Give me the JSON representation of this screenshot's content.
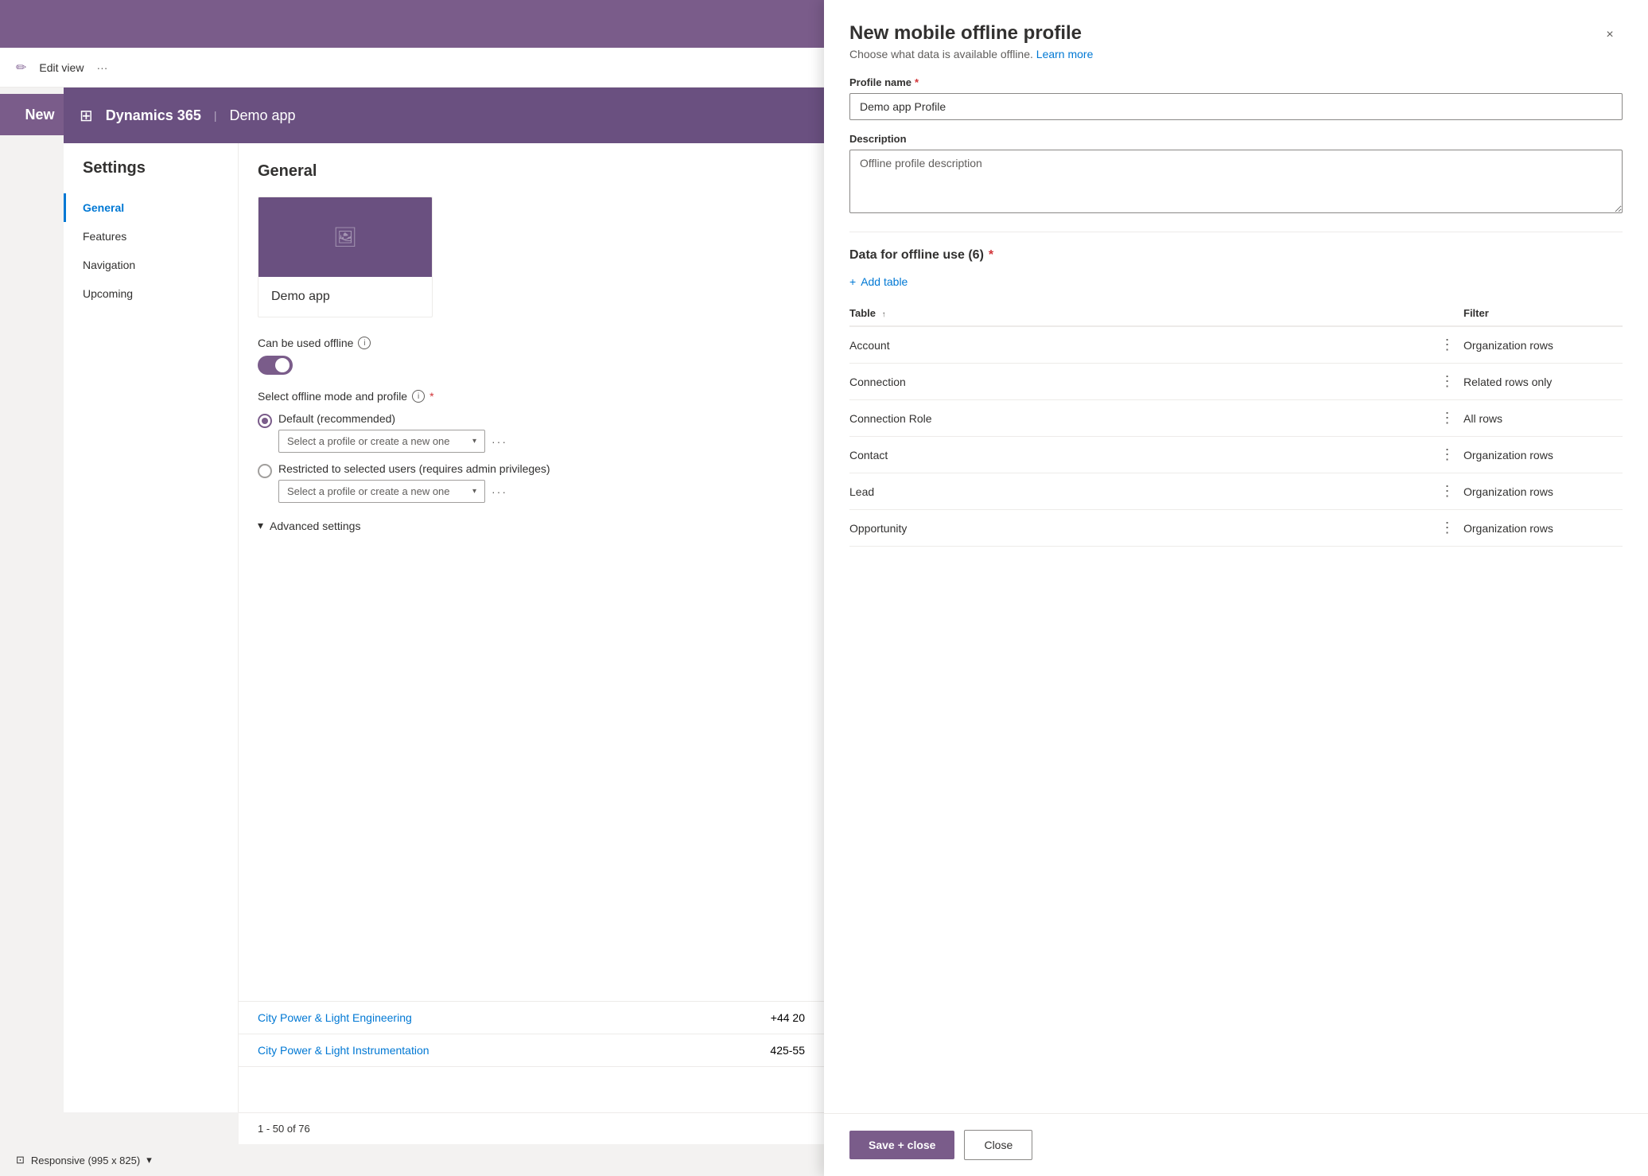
{
  "app": {
    "top_bar_color": "#7a5c8a",
    "dynamics_title": "Dynamics 365",
    "app_name": "Demo app"
  },
  "toolbar": {
    "edit_view": "Edit view",
    "new_btn": "New"
  },
  "settings": {
    "title": "Settings",
    "nav_items": [
      {
        "label": "General",
        "active": true
      },
      {
        "label": "Features",
        "active": false
      },
      {
        "label": "Navigation",
        "active": false
      },
      {
        "label": "Upcoming",
        "active": false
      }
    ]
  },
  "general": {
    "title": "General",
    "app_card_name": "Demo app",
    "offline_label": "Can be used offline",
    "select_mode_label": "Select offline mode and profile",
    "default_option": {
      "label": "Default (recommended)",
      "placeholder": "Select a profile or create a new one",
      "selected": true
    },
    "restricted_option": {
      "label": "Restricted to selected users (requires admin privileges)",
      "placeholder": "Select a profile or create a new one",
      "selected": false
    },
    "advanced_settings": "Advanced settings"
  },
  "data_rows": [
    {
      "name": "City Power & Light Engineering",
      "phone": "+44 20"
    },
    {
      "name": "City Power & Light Instrumentation",
      "phone": "425-55"
    }
  ],
  "pagination": {
    "text": "1 - 50 of 76"
  },
  "responsive": {
    "text": "Responsive (995 x 825)"
  },
  "modal": {
    "title": "New mobile offline profile",
    "subtitle": "Choose what data is available offline.",
    "learn_more": "Learn more",
    "close_label": "×",
    "profile_name_label": "Profile name",
    "profile_name_required": true,
    "profile_name_value": "Demo app Profile",
    "description_label": "Description",
    "description_value": "Offline profile description",
    "data_section_label": "Data for offline use (6)",
    "add_table_label": "+ Add table",
    "table_col_table": "Table",
    "table_col_filter": "Filter",
    "sort_arrow": "↑",
    "tables": [
      {
        "name": "Account",
        "filter": "Organization rows"
      },
      {
        "name": "Connection",
        "filter": "Related rows only"
      },
      {
        "name": "Connection Role",
        "filter": "All rows"
      },
      {
        "name": "Contact",
        "filter": "Organization rows"
      },
      {
        "name": "Lead",
        "filter": "Organization rows"
      },
      {
        "name": "Opportunity",
        "filter": "Organization rows"
      }
    ],
    "save_btn": "Save + close",
    "close_btn": "Close"
  }
}
